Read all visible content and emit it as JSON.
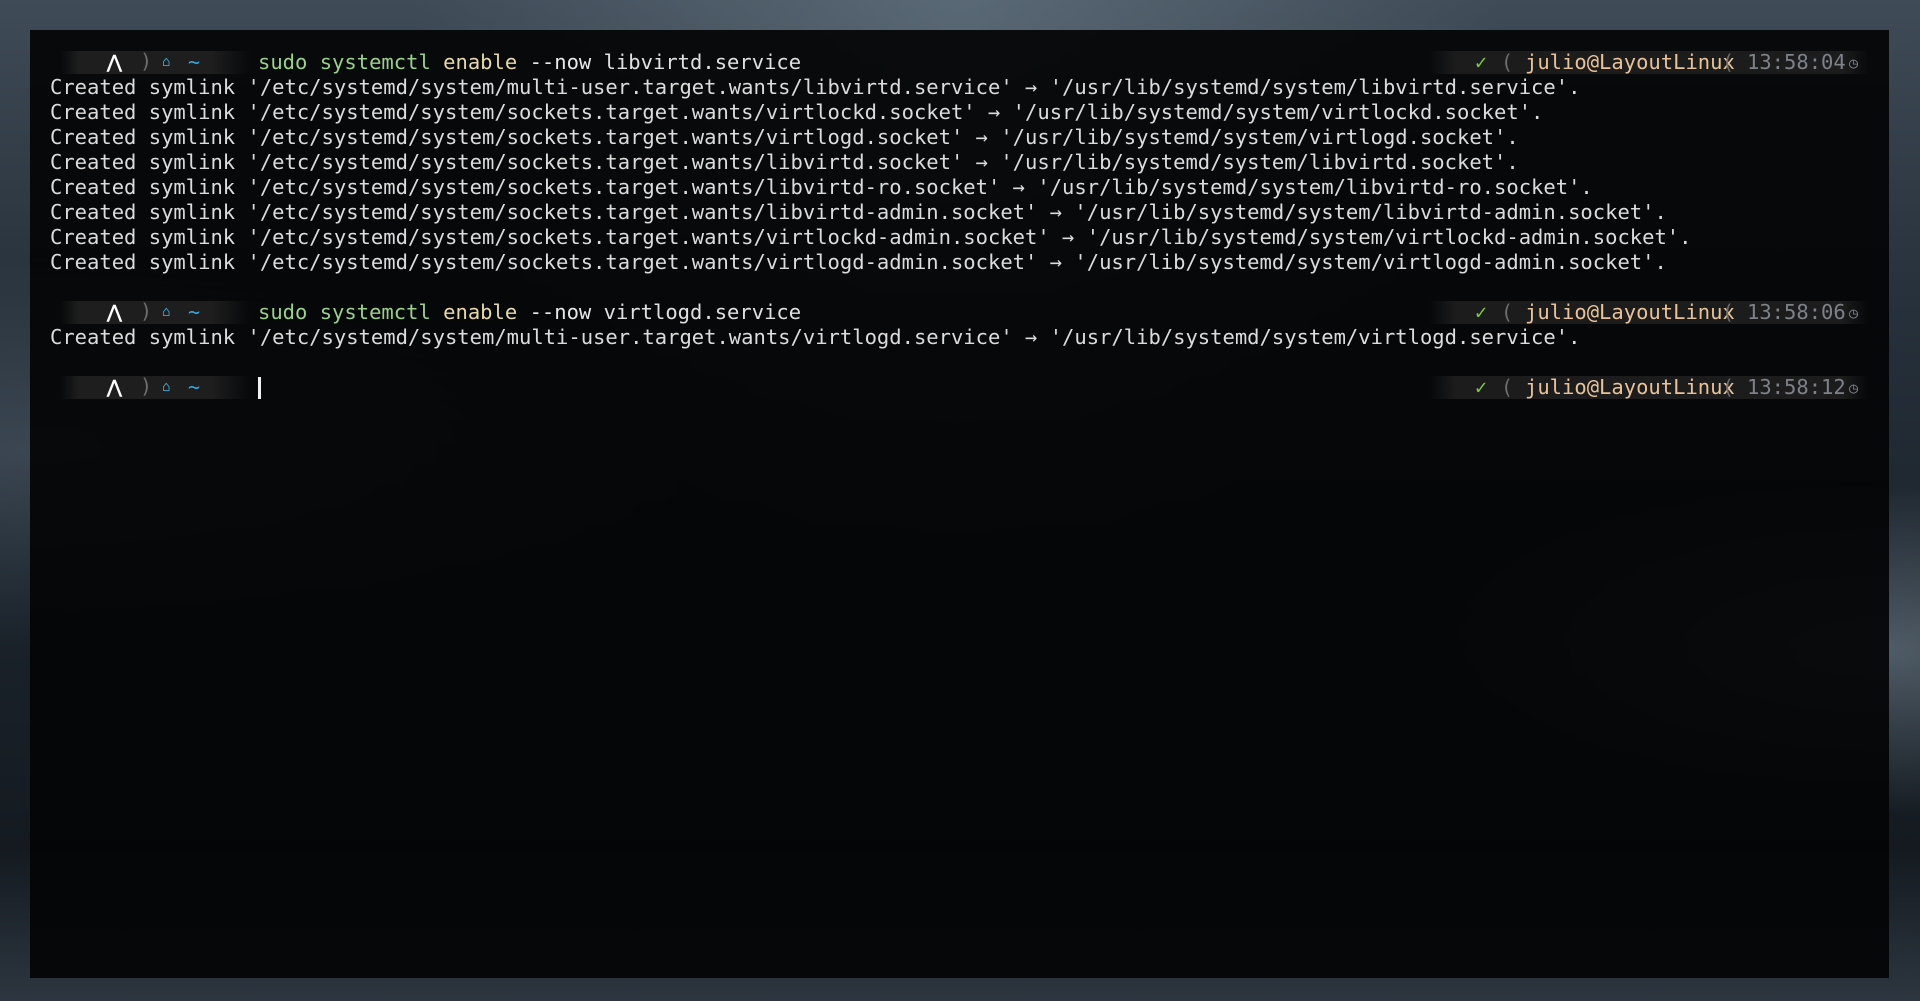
{
  "prompt": {
    "os_icon": "arch-linux-icon",
    "os_glyph": "⋀",
    "separator": ")",
    "home_glyph": "⌂",
    "dir": "~",
    "status_glyph": "✓",
    "right_separator": "(",
    "user_host": "julio@LayoutLinux",
    "clock_glyph": "◷"
  },
  "blocks": [
    {
      "command": {
        "bin": "sudo",
        "sub": "systemctl",
        "verb": "enable",
        "flag": "--now",
        "target": "libvirtd.service"
      },
      "time": "13:58:04",
      "output": [
        "Created symlink '/etc/systemd/system/multi-user.target.wants/libvirtd.service' → '/usr/lib/systemd/system/libvirtd.service'.",
        "Created symlink '/etc/systemd/system/sockets.target.wants/virtlockd.socket' → '/usr/lib/systemd/system/virtlockd.socket'.",
        "Created symlink '/etc/systemd/system/sockets.target.wants/virtlogd.socket' → '/usr/lib/systemd/system/virtlogd.socket'.",
        "Created symlink '/etc/systemd/system/sockets.target.wants/libvirtd.socket' → '/usr/lib/systemd/system/libvirtd.socket'.",
        "Created symlink '/etc/systemd/system/sockets.target.wants/libvirtd-ro.socket' → '/usr/lib/systemd/system/libvirtd-ro.socket'.",
        "Created symlink '/etc/systemd/system/sockets.target.wants/libvirtd-admin.socket' → '/usr/lib/systemd/system/libvirtd-admin.socket'.",
        "Created symlink '/etc/systemd/system/sockets.target.wants/virtlockd-admin.socket' → '/usr/lib/systemd/system/virtlockd-admin.socket'.",
        "Created symlink '/etc/systemd/system/sockets.target.wants/virtlogd-admin.socket' → '/usr/lib/systemd/system/virtlogd-admin.socket'."
      ]
    },
    {
      "command": {
        "bin": "sudo",
        "sub": "systemctl",
        "verb": "enable",
        "flag": "--now",
        "target": "virtlogd.service"
      },
      "time": "13:58:06",
      "output": [
        "Created symlink '/etc/systemd/system/multi-user.target.wants/virtlogd.service' → '/usr/lib/systemd/system/virtlogd.service'."
      ]
    },
    {
      "command": null,
      "time": "13:58:12",
      "output": []
    }
  ]
}
